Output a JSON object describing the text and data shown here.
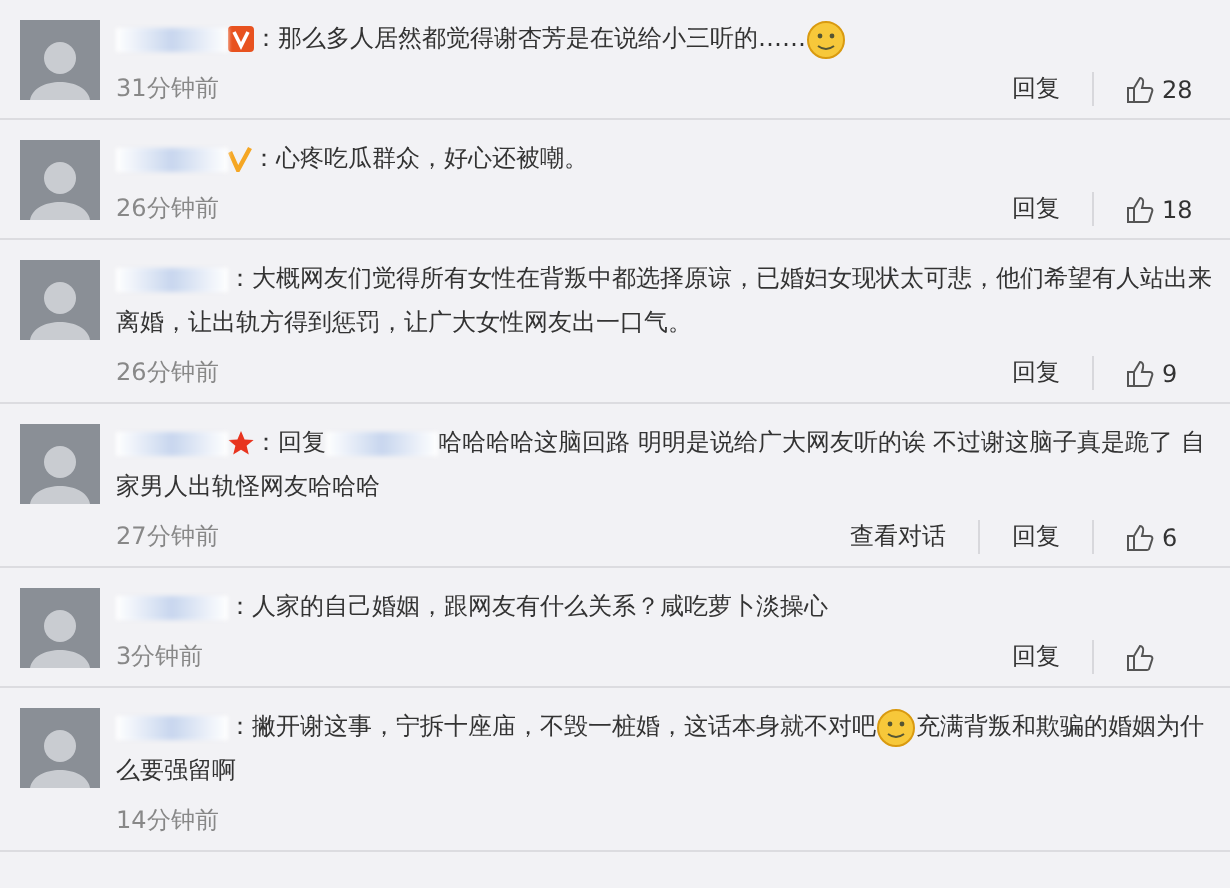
{
  "comments": [
    {
      "badge": {
        "kind": "vip"
      },
      "parts": [
        {
          "kind": "text",
          "text": "：那么多人居然都觉得谢杏芳是在说给小三听的……"
        },
        {
          "kind": "emoji"
        }
      ],
      "time": "31分钟前",
      "actions": [
        "回复"
      ],
      "likes": "28"
    },
    {
      "badge": {
        "kind": "verified"
      },
      "parts": [
        {
          "kind": "text",
          "text": "：心疼吃瓜群众，好心还被嘲。"
        }
      ],
      "time": "26分钟前",
      "actions": [
        "回复"
      ],
      "likes": "18"
    },
    {
      "parts": [
        {
          "kind": "text",
          "text": "：大概网友们觉得所有女性在背叛中都选择原谅，已婚妇女现状太可悲，他们希望有人站出来离婚，让出轨方得到惩罚，让广大女性网友出一口气。"
        }
      ],
      "time": "26分钟前",
      "actions": [
        "回复"
      ],
      "likes": "9"
    },
    {
      "badge": {
        "kind": "star"
      },
      "parts": [
        {
          "kind": "text",
          "text": "：回复"
        },
        {
          "kind": "blurred"
        },
        {
          "kind": "text",
          "text": "哈哈哈哈这脑回路 明明是说给广大网友听的诶 不过谢这脑子真是跪了 自家男人出轨怪网友哈哈哈"
        }
      ],
      "time": "27分钟前",
      "actions": [
        "查看对话",
        "回复"
      ],
      "likes": "6"
    },
    {
      "parts": [
        {
          "kind": "text",
          "text": "：人家的自己婚姻，跟网友有什么关系？咸吃萝卜淡操心"
        }
      ],
      "time": "3分钟前",
      "actions": [
        "回复"
      ]
    },
    {
      "parts": [
        {
          "kind": "text",
          "text": "：撇开谢这事，宁拆十座庙，不毁一桩婚，这话本身就不对吧"
        },
        {
          "kind": "emoji"
        },
        {
          "kind": "text",
          "text": "充满背叛和欺骗的婚姻为什么要强留啊"
        }
      ],
      "time": "14分钟前"
    }
  ]
}
